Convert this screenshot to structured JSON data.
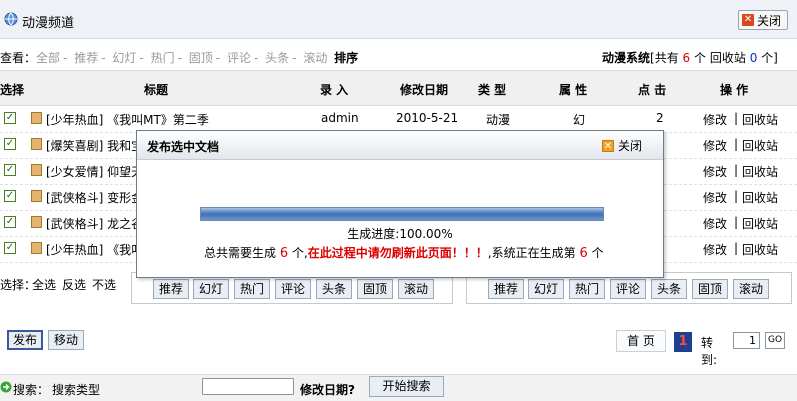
{
  "header": {
    "title": "动漫频道",
    "close_label": "关闭"
  },
  "filter": {
    "label": "查看：",
    "links": [
      "全部",
      "推荐",
      "幻灯",
      "热门",
      "固顶",
      "评论",
      "头条",
      "滚动"
    ],
    "separator": "-",
    "sort_label": "排序",
    "system_label": "动漫系统",
    "total_prefix": "[共有",
    "total_count": "6",
    "total_suffix": "个",
    "recycle_label": "回收站",
    "recycle_count": "0",
    "recycle_suffix": "个]"
  },
  "table": {
    "headers": [
      "选择",
      "标题",
      "录 入",
      "修改日期",
      "类 型",
      "属 性",
      "点 击",
      "操 作"
    ],
    "rows": [
      {
        "title": "[少年热血] 《我叫MT》第二季",
        "author": "admin",
        "date": "2010-5-21",
        "type": "动漫",
        "attr": "幻",
        "clicks": "2",
        "edit": "修改",
        "recycle": "回收站"
      },
      {
        "title": "[爆笑喜剧] 我和宝",
        "author": "",
        "date": "",
        "type": "",
        "attr": "",
        "clicks": "",
        "edit": "修改",
        "recycle": "回收站"
      },
      {
        "title": "[少女爱情] 仰望天",
        "author": "",
        "date": "",
        "type": "",
        "attr": "",
        "clicks": "",
        "edit": "修改",
        "recycle": "回收站"
      },
      {
        "title": "[武侠格斗] 变形金",
        "author": "",
        "date": "",
        "type": "",
        "attr": "",
        "clicks": "",
        "edit": "修改",
        "recycle": "回收站"
      },
      {
        "title": "[武侠格斗] 龙之谷",
        "author": "",
        "date": "",
        "type": "",
        "attr": "",
        "clicks": "",
        "edit": "修改",
        "recycle": "回收站"
      },
      {
        "title": "[少年热血] 《我叫",
        "author": "",
        "date": "",
        "type": "",
        "attr": "",
        "clicks": "",
        "edit": "修改",
        "recycle": "回收站"
      }
    ],
    "edit_sep": "|"
  },
  "selection": {
    "label": "选择：",
    "all": "全选",
    "invert": "反选",
    "none": "不选",
    "set_buttons": [
      "推荐",
      "幻灯",
      "热门",
      "评论",
      "头条",
      "固顶",
      "滚动"
    ],
    "unset_buttons": [
      "推荐",
      "幻灯",
      "热门",
      "评论",
      "头条",
      "固顶",
      "滚动"
    ]
  },
  "actions": {
    "publish": "发布",
    "move": "移动"
  },
  "pager": {
    "first": "首 页",
    "current": "1",
    "goto_label": "转到:",
    "goto_value": "1",
    "go": "GO"
  },
  "search": {
    "label": "搜索：",
    "type_label": "搜索类型",
    "date_label": "修改日期?",
    "button": "开始搜索"
  },
  "modal": {
    "title": "发布选中文档",
    "close": "关闭",
    "progress_percent": 100,
    "progress_label": "生成进度:100.00%",
    "total_prefix": "总共需要生成",
    "total_count": "6",
    "total_suffix": "个,",
    "warning": "在此过程中请勿刷新此页面！！！",
    "current_prefix": ",系统正在生成第",
    "current_count": "6",
    "current_suffix": "个"
  },
  "colors": {
    "warning": "#dd0000",
    "progress": "#3f6fb3",
    "page_badge": "#1f3f8f"
  }
}
